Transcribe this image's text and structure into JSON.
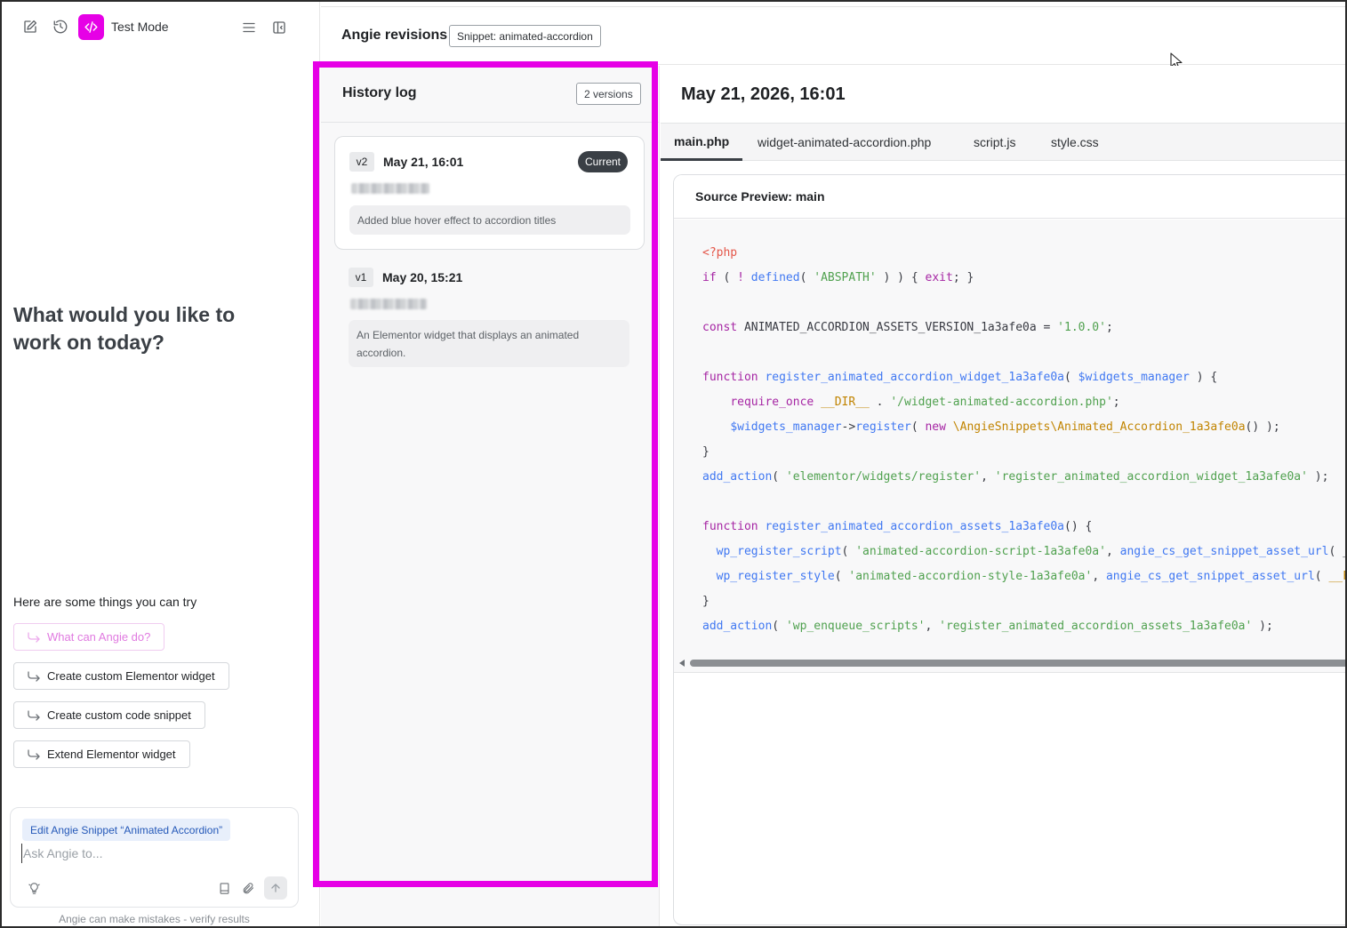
{
  "angie": {
    "mode_label": "Test Mode",
    "welcome_heading": "What would you like to work on today?",
    "suggestions_title": "Here are some things you can try",
    "suggestions": [
      {
        "label": "What can Angie do?"
      },
      {
        "label": "Create custom Elementor widget"
      },
      {
        "label": "Create custom code snippet"
      },
      {
        "label": "Extend Elementor widget"
      }
    ],
    "composer": {
      "context_tag": "Edit Angie Snippet “Animated Accordion”",
      "placeholder": "Ask Angie to..."
    },
    "disclaimer": "Angie can make mistakes - verify results",
    "accent_color": "#e600e6"
  },
  "revisions": {
    "title": "Angie revisions",
    "snippet_tag": "Snippet: animated-accordion"
  },
  "history": {
    "title": "History log",
    "count_label": "2 versions",
    "versions": [
      {
        "badge": "v2",
        "date": "May 21, 16:01",
        "status": "Current",
        "description": "Added blue hover effect to accordion titles"
      },
      {
        "badge": "v1",
        "date": "May 20, 15:21",
        "description": "An Elementor widget that displays an animated accordion."
      }
    ]
  },
  "source": {
    "date_heading": "May 21, 2026, 16:01",
    "tabs": [
      {
        "label": "main.php",
        "active": true
      },
      {
        "label": "widget-animated-accordion.php"
      },
      {
        "label": "script.js"
      },
      {
        "label": "style.css"
      }
    ],
    "preview_title": "Source Preview: main",
    "code_lines": [
      "<?php",
      "if ( ! defined( 'ABSPATH' ) ) { exit; }",
      "",
      "const ANIMATED_ACCORDION_ASSETS_VERSION_1a3afe0a = '1.0.0';",
      "",
      "function register_animated_accordion_widget_1a3afe0a( $widgets_manager ) {",
      "    require_once __DIR__ . '/widget-animated-accordion.php';",
      "    $widgets_manager->register( new \\AngieSnippets\\Animated_Accordion_1a3afe0a() );",
      "}",
      "add_action( 'elementor/widgets/register', 'register_animated_accordion_widget_1a3afe0a' );",
      "",
      "function register_animated_accordion_assets_1a3afe0a() {",
      "  wp_register_script( 'animated-accordion-script-1a3afe0a', angie_cs_get_snippet_asset_url( __",
      "  wp_register_style( 'animated-accordion-style-1a3afe0a', angie_cs_get_snippet_asset_url( __FI",
      "}",
      "add_action( 'wp_enqueue_scripts', 'register_animated_accordion_assets_1a3afe0a' );"
    ]
  }
}
